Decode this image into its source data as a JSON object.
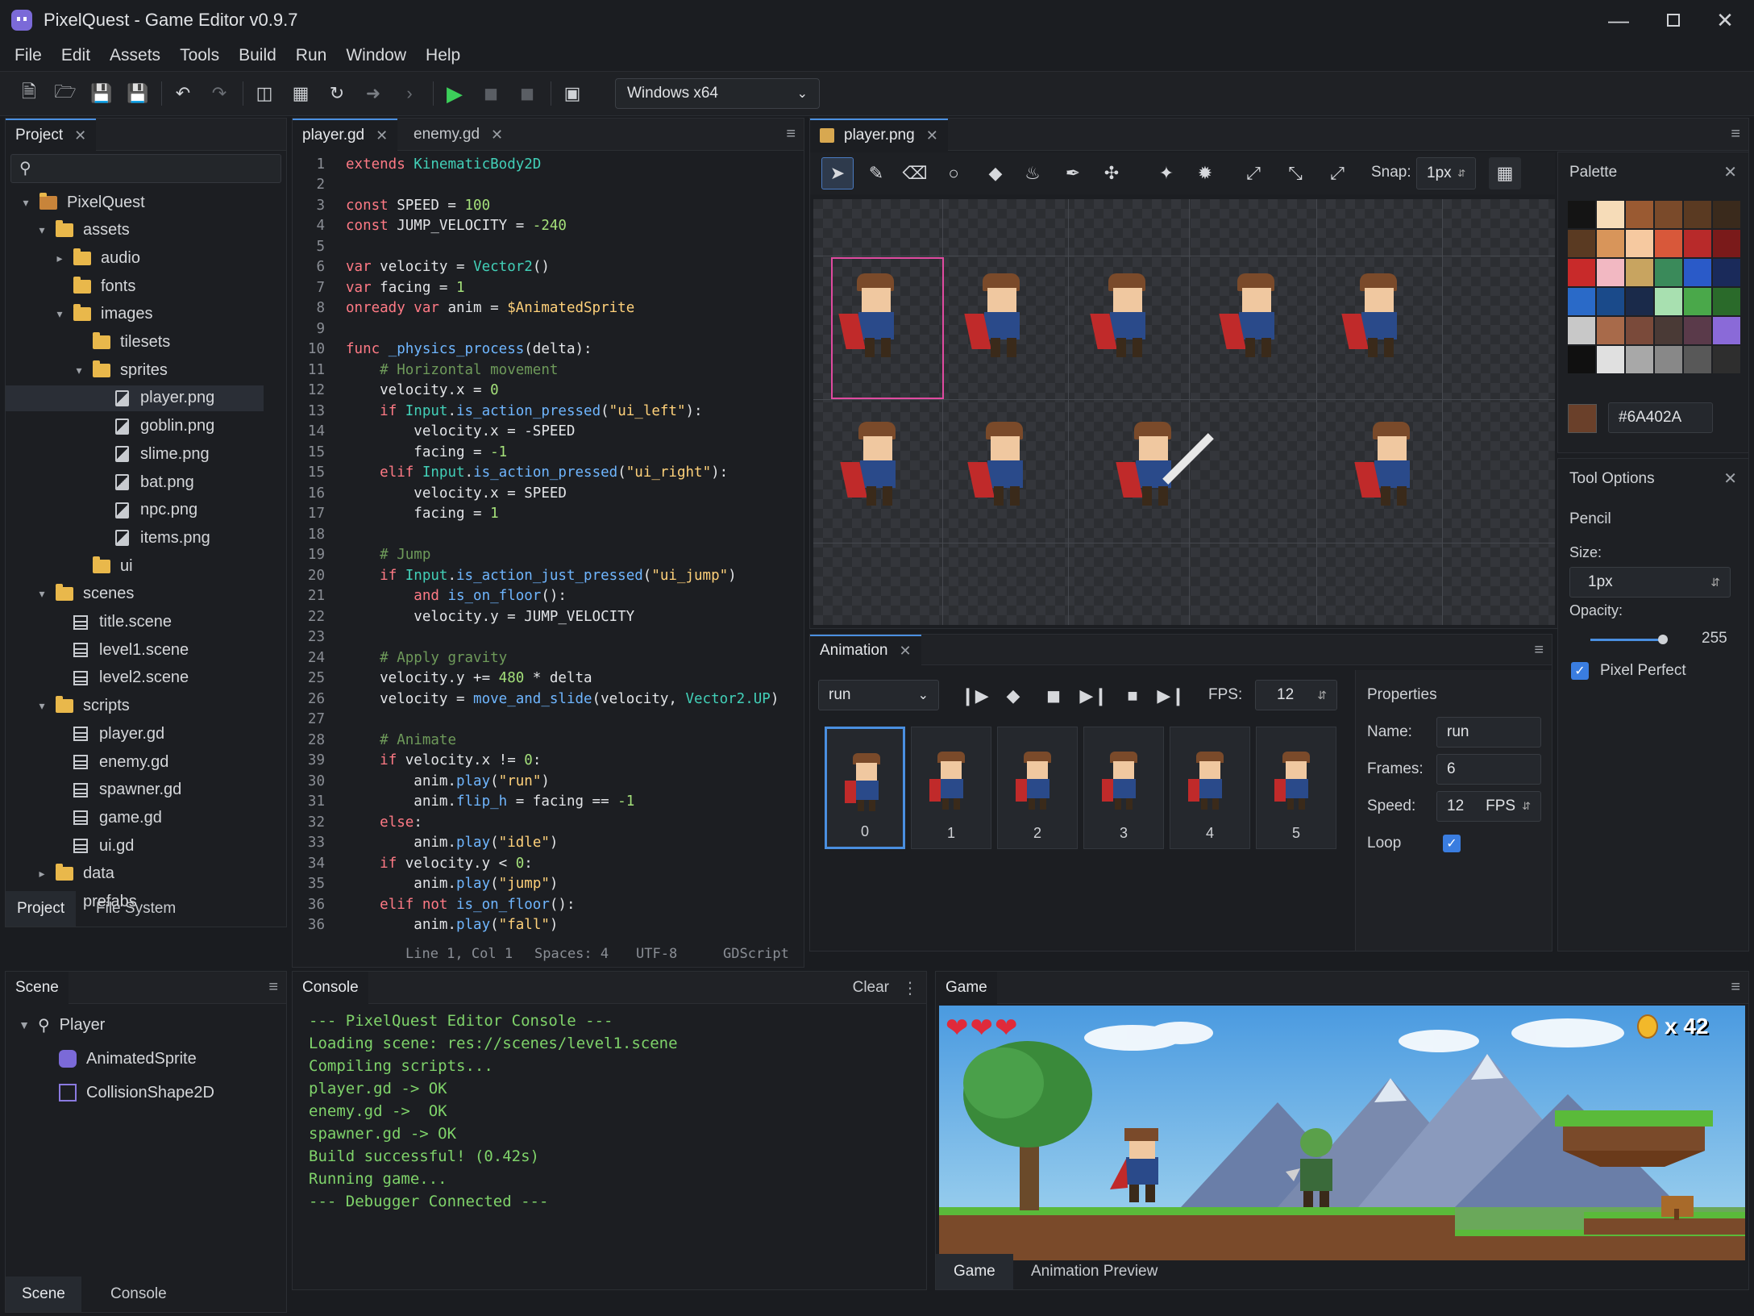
{
  "window": {
    "title": "PixelQuest - Game Editor v0.9.7"
  },
  "menu": [
    "File",
    "Edit",
    "Assets",
    "Tools",
    "Build",
    "Run",
    "Window",
    "Help"
  ],
  "toolbar": {
    "platform": "Windows x64"
  },
  "project": {
    "tab": "Project",
    "search_placeholder": "",
    "tree": [
      {
        "label": "PixelQuest",
        "depth": 0,
        "kind": "root",
        "arrow": "open"
      },
      {
        "label": "assets",
        "depth": 1,
        "kind": "folder",
        "arrow": "open"
      },
      {
        "label": "audio",
        "depth": 2,
        "kind": "folder",
        "arrow": "closed"
      },
      {
        "label": "fonts",
        "depth": 2,
        "kind": "folder",
        "arrow": "none"
      },
      {
        "label": "images",
        "depth": 2,
        "kind": "folder",
        "arrow": "open"
      },
      {
        "label": "tilesets",
        "depth": 3,
        "kind": "folder",
        "arrow": "none"
      },
      {
        "label": "sprites",
        "depth": 3,
        "kind": "folder",
        "arrow": "open"
      },
      {
        "label": "player.png",
        "depth": 4,
        "kind": "image",
        "arrow": "none",
        "selected": true
      },
      {
        "label": "goblin.png",
        "depth": 4,
        "kind": "image",
        "arrow": "none"
      },
      {
        "label": "slime.png",
        "depth": 4,
        "kind": "image",
        "arrow": "none"
      },
      {
        "label": "bat.png",
        "depth": 4,
        "kind": "image",
        "arrow": "none"
      },
      {
        "label": "npc.png",
        "depth": 4,
        "kind": "image",
        "arrow": "none"
      },
      {
        "label": "items.png",
        "depth": 4,
        "kind": "image",
        "arrow": "none"
      },
      {
        "label": "ui",
        "depth": 3,
        "kind": "folder",
        "arrow": "none"
      },
      {
        "label": "scenes",
        "depth": 1,
        "kind": "folder",
        "arrow": "open"
      },
      {
        "label": "title.scene",
        "depth": 2,
        "kind": "scene",
        "arrow": "none"
      },
      {
        "label": "level1.scene",
        "depth": 2,
        "kind": "scene",
        "arrow": "none"
      },
      {
        "label": "level2.scene",
        "depth": 2,
        "kind": "scene",
        "arrow": "none"
      },
      {
        "label": "scripts",
        "depth": 1,
        "kind": "folder",
        "arrow": "open"
      },
      {
        "label": "player.gd",
        "depth": 2,
        "kind": "scene",
        "arrow": "none"
      },
      {
        "label": "enemy.gd",
        "depth": 2,
        "kind": "scene",
        "arrow": "none"
      },
      {
        "label": "spawner.gd",
        "depth": 2,
        "kind": "scene",
        "arrow": "none"
      },
      {
        "label": "game.gd",
        "depth": 2,
        "kind": "scene",
        "arrow": "none"
      },
      {
        "label": "ui.gd",
        "depth": 2,
        "kind": "scene",
        "arrow": "none"
      },
      {
        "label": "data",
        "depth": 1,
        "kind": "folder",
        "arrow": "closed"
      },
      {
        "label": "prefabs",
        "depth": 1,
        "kind": "folder",
        "arrow": "closed"
      }
    ],
    "bottom_tabs": [
      "Project",
      "File System"
    ]
  },
  "editor": {
    "tabs": [
      "player.gd",
      "enemy.gd"
    ],
    "lines": [
      {
        "n": "1",
        "t": [
          [
            "kw",
            "extends "
          ],
          [
            "ty",
            "KinematicBody2D"
          ]
        ]
      },
      {
        "n": "2",
        "t": []
      },
      {
        "n": "3",
        "t": [
          [
            "kw",
            "const "
          ],
          [
            "tx",
            "SPEED = "
          ],
          [
            "num",
            "100"
          ]
        ]
      },
      {
        "n": "4",
        "t": [
          [
            "kw",
            "const "
          ],
          [
            "tx",
            "JUMP_VELOCITY = "
          ],
          [
            "num",
            "-240"
          ]
        ]
      },
      {
        "n": "5",
        "t": []
      },
      {
        "n": "6",
        "t": [
          [
            "kw",
            "var "
          ],
          [
            "tx",
            "velocity = "
          ],
          [
            "ty",
            "Vector2"
          ],
          [
            "tx",
            "()"
          ]
        ]
      },
      {
        "n": "7",
        "t": [
          [
            "kw",
            "var "
          ],
          [
            "tx",
            "facing = "
          ],
          [
            "num",
            "1"
          ]
        ]
      },
      {
        "n": "8",
        "t": [
          [
            "kw",
            "onready var "
          ],
          [
            "tx",
            "anim = "
          ],
          [
            "str",
            "$AnimatedSprite"
          ]
        ]
      },
      {
        "n": "9",
        "t": []
      },
      {
        "n": "10",
        "t": [
          [
            "kw",
            "func "
          ],
          [
            "fn",
            "_physics_process"
          ],
          [
            "tx",
            "(delta):"
          ]
        ]
      },
      {
        "n": "11",
        "t": [
          [
            "tx",
            "    "
          ],
          [
            "cm",
            "# Horizontal movement"
          ]
        ]
      },
      {
        "n": "12",
        "t": [
          [
            "tx",
            "    velocity.x = "
          ],
          [
            "num",
            "0"
          ]
        ]
      },
      {
        "n": "13",
        "t": [
          [
            "tx",
            "    "
          ],
          [
            "kw",
            "if "
          ],
          [
            "ty",
            "Input"
          ],
          [
            "tx",
            "."
          ],
          [
            "fn",
            "is_action_pressed"
          ],
          [
            "tx",
            "("
          ],
          [
            "str",
            "\"ui_left\""
          ],
          [
            "tx",
            "):"
          ]
        ]
      },
      {
        "n": "14",
        "t": [
          [
            "tx",
            "        velocity.x = -SPEED"
          ]
        ]
      },
      {
        "n": "15",
        "t": [
          [
            "tx",
            "        facing = "
          ],
          [
            "num",
            "-1"
          ]
        ]
      },
      {
        "n": "15",
        "t": [
          [
            "tx",
            "    "
          ],
          [
            "kw",
            "elif "
          ],
          [
            "ty",
            "Input"
          ],
          [
            "tx",
            "."
          ],
          [
            "fn",
            "is_action_pressed"
          ],
          [
            "tx",
            "("
          ],
          [
            "str",
            "\"ui_right\""
          ],
          [
            "tx",
            "):"
          ]
        ]
      },
      {
        "n": "16",
        "t": [
          [
            "tx",
            "        velocity.x = SPEED"
          ]
        ]
      },
      {
        "n": "17",
        "t": [
          [
            "tx",
            "        facing = "
          ],
          [
            "num",
            "1"
          ]
        ]
      },
      {
        "n": "18",
        "t": []
      },
      {
        "n": "19",
        "t": [
          [
            "tx",
            "    "
          ],
          [
            "cm",
            "# Jump"
          ]
        ]
      },
      {
        "n": "20",
        "t": [
          [
            "tx",
            "    "
          ],
          [
            "kw",
            "if "
          ],
          [
            "ty",
            "Input"
          ],
          [
            "tx",
            "."
          ],
          [
            "fn",
            "is_action_just_pressed"
          ],
          [
            "tx",
            "("
          ],
          [
            "str",
            "\"ui_jump\""
          ],
          [
            "tx",
            ")"
          ]
        ]
      },
      {
        "n": "21",
        "t": [
          [
            "tx",
            "        "
          ],
          [
            "kw",
            "and "
          ],
          [
            "fn",
            "is_on_floor"
          ],
          [
            "tx",
            "():"
          ]
        ]
      },
      {
        "n": "22",
        "t": [
          [
            "tx",
            "        velocity.y = JUMP_VELOCITY"
          ]
        ]
      },
      {
        "n": "23",
        "t": []
      },
      {
        "n": "24",
        "t": [
          [
            "tx",
            "    "
          ],
          [
            "cm",
            "# Apply gravity"
          ]
        ]
      },
      {
        "n": "25",
        "t": [
          [
            "tx",
            "    velocity.y += "
          ],
          [
            "num",
            "480"
          ],
          [
            "tx",
            " * delta"
          ]
        ]
      },
      {
        "n": "26",
        "t": [
          [
            "tx",
            "    velocity = "
          ],
          [
            "fn",
            "move_and_slide"
          ],
          [
            "tx",
            "(velocity, "
          ],
          [
            "ty",
            "Vector2.UP"
          ],
          [
            "tx",
            ")"
          ]
        ]
      },
      {
        "n": "27",
        "t": []
      },
      {
        "n": "28",
        "t": [
          [
            "tx",
            "    "
          ],
          [
            "cm",
            "# Animate"
          ]
        ]
      },
      {
        "n": "39",
        "t": [
          [
            "tx",
            "    "
          ],
          [
            "kw",
            "if "
          ],
          [
            "tx",
            "velocity.x != "
          ],
          [
            "num",
            "0"
          ],
          [
            "tx",
            ":"
          ]
        ]
      },
      {
        "n": "30",
        "t": [
          [
            "tx",
            "        anim."
          ],
          [
            "fn",
            "play"
          ],
          [
            "tx",
            "("
          ],
          [
            "str",
            "\"run\""
          ],
          [
            "tx",
            ")"
          ]
        ]
      },
      {
        "n": "31",
        "t": [
          [
            "tx",
            "        anim."
          ],
          [
            "fn",
            "flip_h"
          ],
          [
            "tx",
            " = facing == "
          ],
          [
            "num",
            "-1"
          ]
        ]
      },
      {
        "n": "32",
        "t": [
          [
            "tx",
            "    "
          ],
          [
            "kw",
            "else"
          ],
          [
            "tx",
            ":"
          ]
        ]
      },
      {
        "n": "33",
        "t": [
          [
            "tx",
            "        anim."
          ],
          [
            "fn",
            "play"
          ],
          [
            "tx",
            "("
          ],
          [
            "str",
            "\"idle\""
          ],
          [
            "tx",
            ")"
          ]
        ]
      },
      {
        "n": "34",
        "t": [
          [
            "tx",
            "    "
          ],
          [
            "kw",
            "if "
          ],
          [
            "tx",
            "velocity.y < "
          ],
          [
            "num",
            "0"
          ],
          [
            "tx",
            ":"
          ]
        ]
      },
      {
        "n": "35",
        "t": [
          [
            "tx",
            "        anim."
          ],
          [
            "fn",
            "play"
          ],
          [
            "tx",
            "("
          ],
          [
            "str",
            "\"jump\""
          ],
          [
            "tx",
            ")"
          ]
        ]
      },
      {
        "n": "36",
        "t": [
          [
            "tx",
            "    "
          ],
          [
            "kw",
            "elif not "
          ],
          [
            "fn",
            "is_on_floor"
          ],
          [
            "tx",
            "():"
          ]
        ]
      },
      {
        "n": "36",
        "t": [
          [
            "tx",
            "        anim."
          ],
          [
            "fn",
            "play"
          ],
          [
            "tx",
            "("
          ],
          [
            "str",
            "\"fall\""
          ],
          [
            "tx",
            ")"
          ]
        ]
      }
    ],
    "status": {
      "pos": "Line 1, Col 1",
      "spaces": "Spaces: 4",
      "enc": "UTF-8",
      "lang": "GDScript"
    }
  },
  "sprite_editor": {
    "tab": "player.png",
    "snap_label": "Snap:",
    "snap_value": "1px"
  },
  "palette": {
    "title": "Palette",
    "colors": [
      "#141414",
      "#f6dcb8",
      "#9a5a32",
      "#7a4a2a",
      "#5a3a22",
      "#3a2a1c",
      "#5a3a22",
      "#d8955a",
      "#f6c9a0",
      "#d8583a",
      "#b82a2a",
      "#7a1a1a",
      "#c82a2a",
      "#f2b8c2",
      "#c8a460",
      "#3a8a5a",
      "#2a5ac8",
      "#1a2a5a",
      "#2a6ac8",
      "#1a4a8a",
      "#1a2a4a",
      "#a8e0b0",
      "#4aa84a",
      "#2a6a2a",
      "#c8c8c8",
      "#a86a4a",
      "#7a4a3a",
      "#4a3a36",
      "#5a3a4a",
      "#8a6ad8",
      "#101010",
      "#e0e0e0",
      "#a8a8a8",
      "#888888",
      "#585858",
      "#2e2e2e"
    ],
    "current_color": "#6A402A"
  },
  "tool_options": {
    "title": "Tool Options",
    "tool": "Pencil",
    "size_label": "Size:",
    "size_value": "1px",
    "opacity_label": "Opacity:",
    "opacity_value": "255",
    "pixel_perfect": "Pixel Perfect"
  },
  "animation": {
    "tab": "Animation",
    "current": "run",
    "fps_label": "FPS:",
    "fps_value": "12",
    "frames": [
      "0",
      "1",
      "2",
      "3",
      "4",
      "5"
    ],
    "properties": {
      "title": "Properties",
      "name_label": "Name:",
      "name_value": "run",
      "frames_label": "Frames:",
      "frames_value": "6",
      "speed_label": "Speed:",
      "speed_value": "12",
      "speed_unit": "FPS",
      "loop_label": "Loop"
    }
  },
  "scene": {
    "tab": "Scene",
    "nodes": [
      "Player",
      "AnimatedSprite",
      "CollisionShape2D"
    ],
    "bottom_tabs": [
      "Scene",
      "Console"
    ]
  },
  "console": {
    "tab": "Console",
    "clear": "Clear",
    "lines": [
      "--- PixelQuest Editor Console ---",
      "Loading scene: res://scenes/level1.scene",
      "Compiling scripts...",
      "player.gd -> OK",
      "enemy.gd ->  OK",
      "spawner.gd -> OK",
      "Build successful! (0.42s)",
      "Running game...",
      "--- Debugger Connected ---"
    ]
  },
  "game": {
    "tab": "Game",
    "coins": "x 42",
    "hearts": 3,
    "bottom_tabs": [
      "Game",
      "Animation Preview"
    ]
  }
}
